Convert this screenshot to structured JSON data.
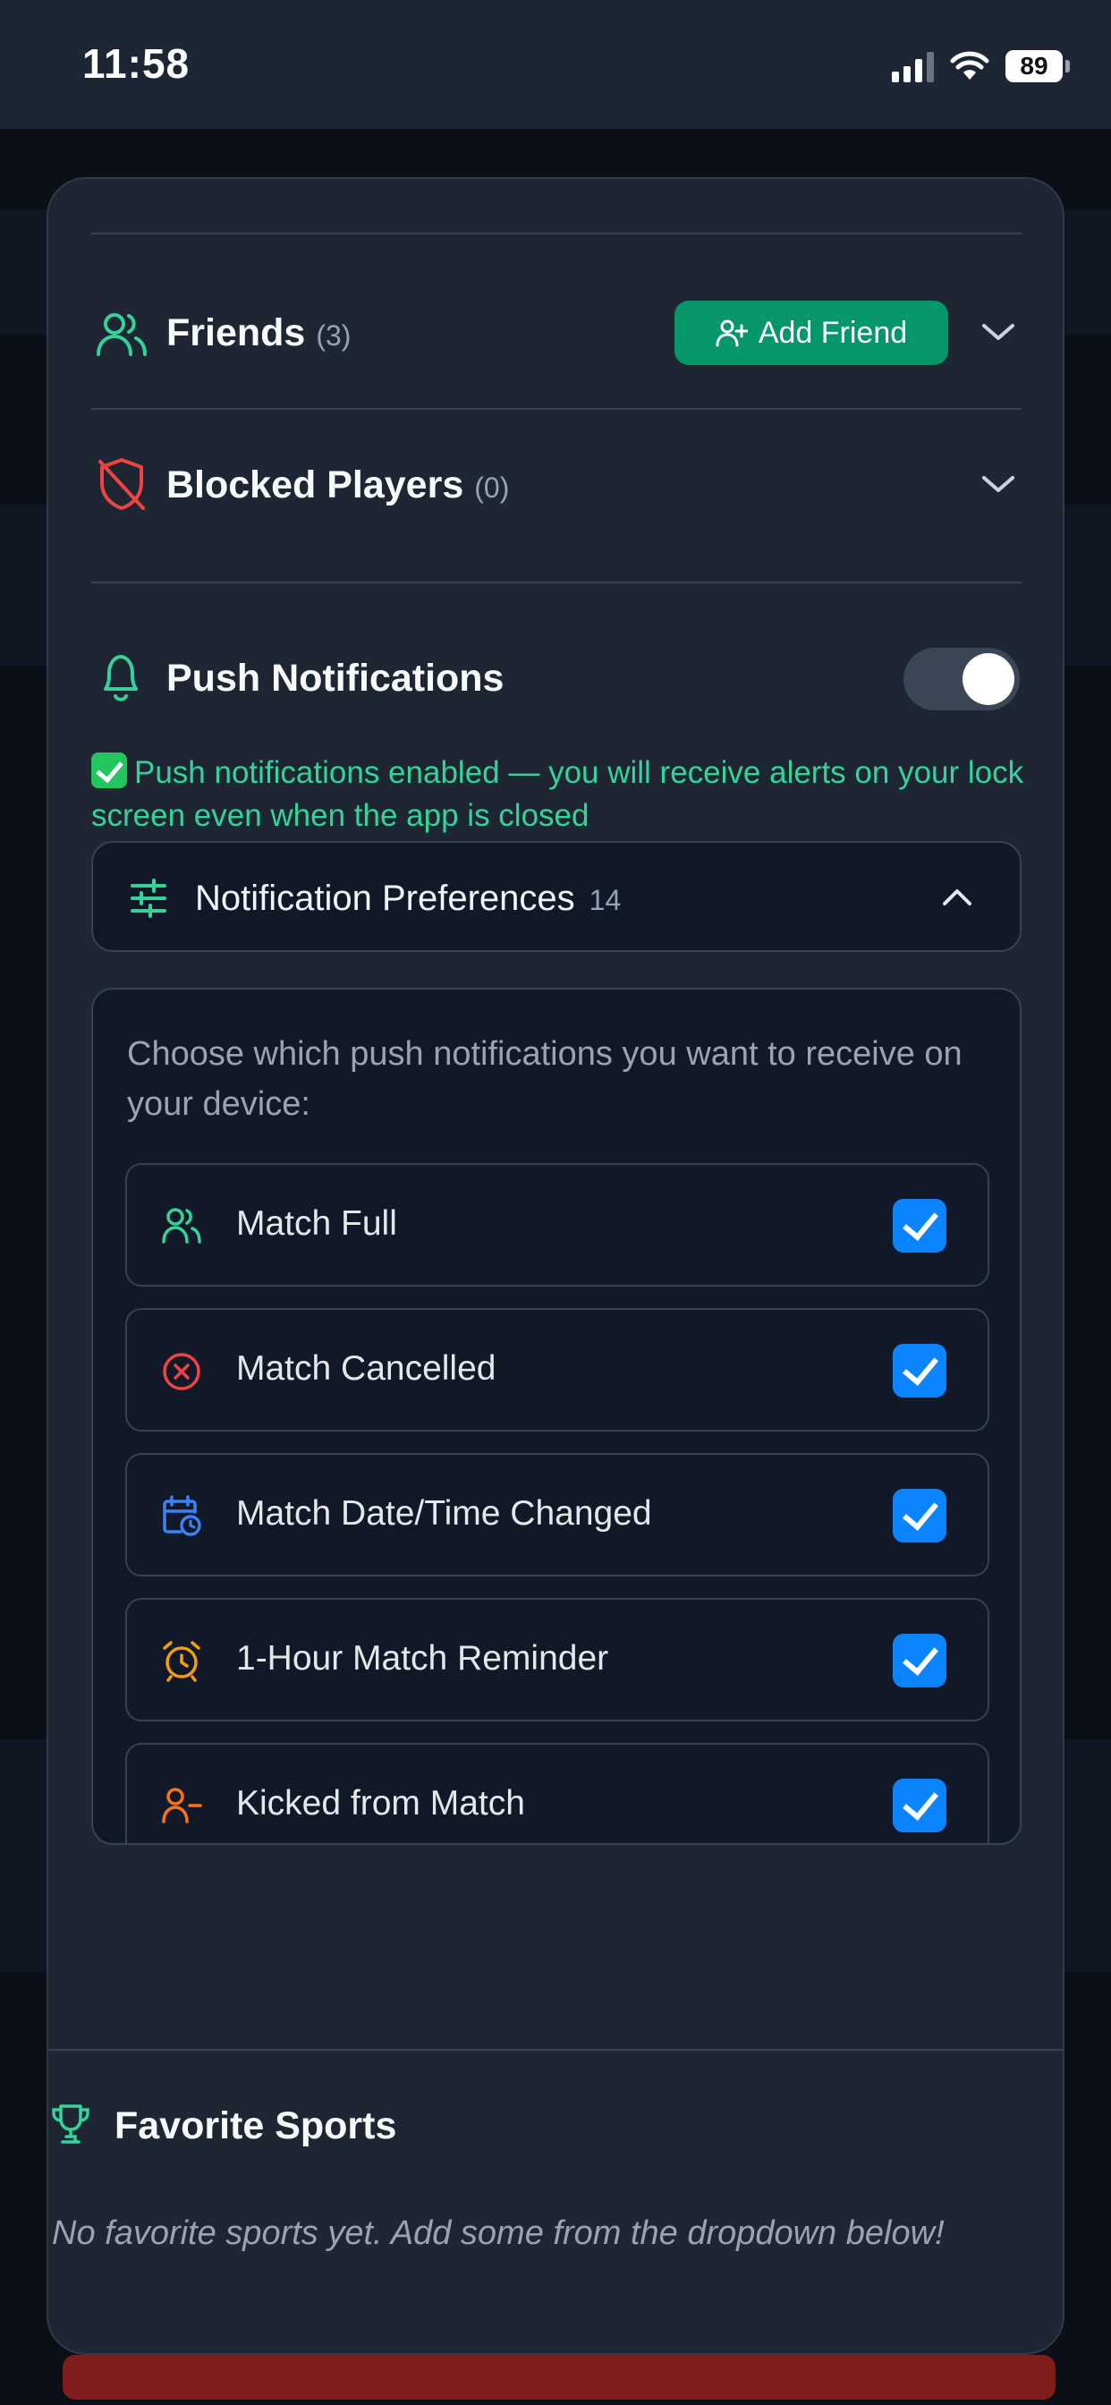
{
  "status_bar": {
    "time": "11:58",
    "battery": "89"
  },
  "friends": {
    "title": "Friends",
    "count": "(3)",
    "add_button": "Add Friend"
  },
  "blocked": {
    "title": "Blocked Players",
    "count": "(0)"
  },
  "push": {
    "title": "Push Notifications",
    "enabled": true,
    "message": "Push notifications enabled — you will receive alerts on your lock screen even when the app is closed"
  },
  "preferences": {
    "title": "Notification Preferences",
    "count": "14",
    "description": "Choose which push notifications you want to receive on your device:",
    "items": [
      {
        "label": "Match Full",
        "icon": "users-icon",
        "checked": true
      },
      {
        "label": "Match Cancelled",
        "icon": "x-circle-icon",
        "checked": true
      },
      {
        "label": "Match Date/Time Changed",
        "icon": "calendar-clock-icon",
        "checked": true
      },
      {
        "label": "1-Hour Match Reminder",
        "icon": "alarm-clock-icon",
        "checked": true
      },
      {
        "label": "Kicked from Match",
        "icon": "user-minus-icon",
        "checked": true
      }
    ]
  },
  "favorites": {
    "title": "Favorite Sports",
    "empty_message": "No favorite sports yet. Add some from the dropdown below!"
  },
  "colors": {
    "accent_green": "#059669",
    "success_text": "#34d399",
    "danger": "#ef4444",
    "checkbox_blue": "#0a84ff",
    "sheet_bg": "#1e2633"
  }
}
